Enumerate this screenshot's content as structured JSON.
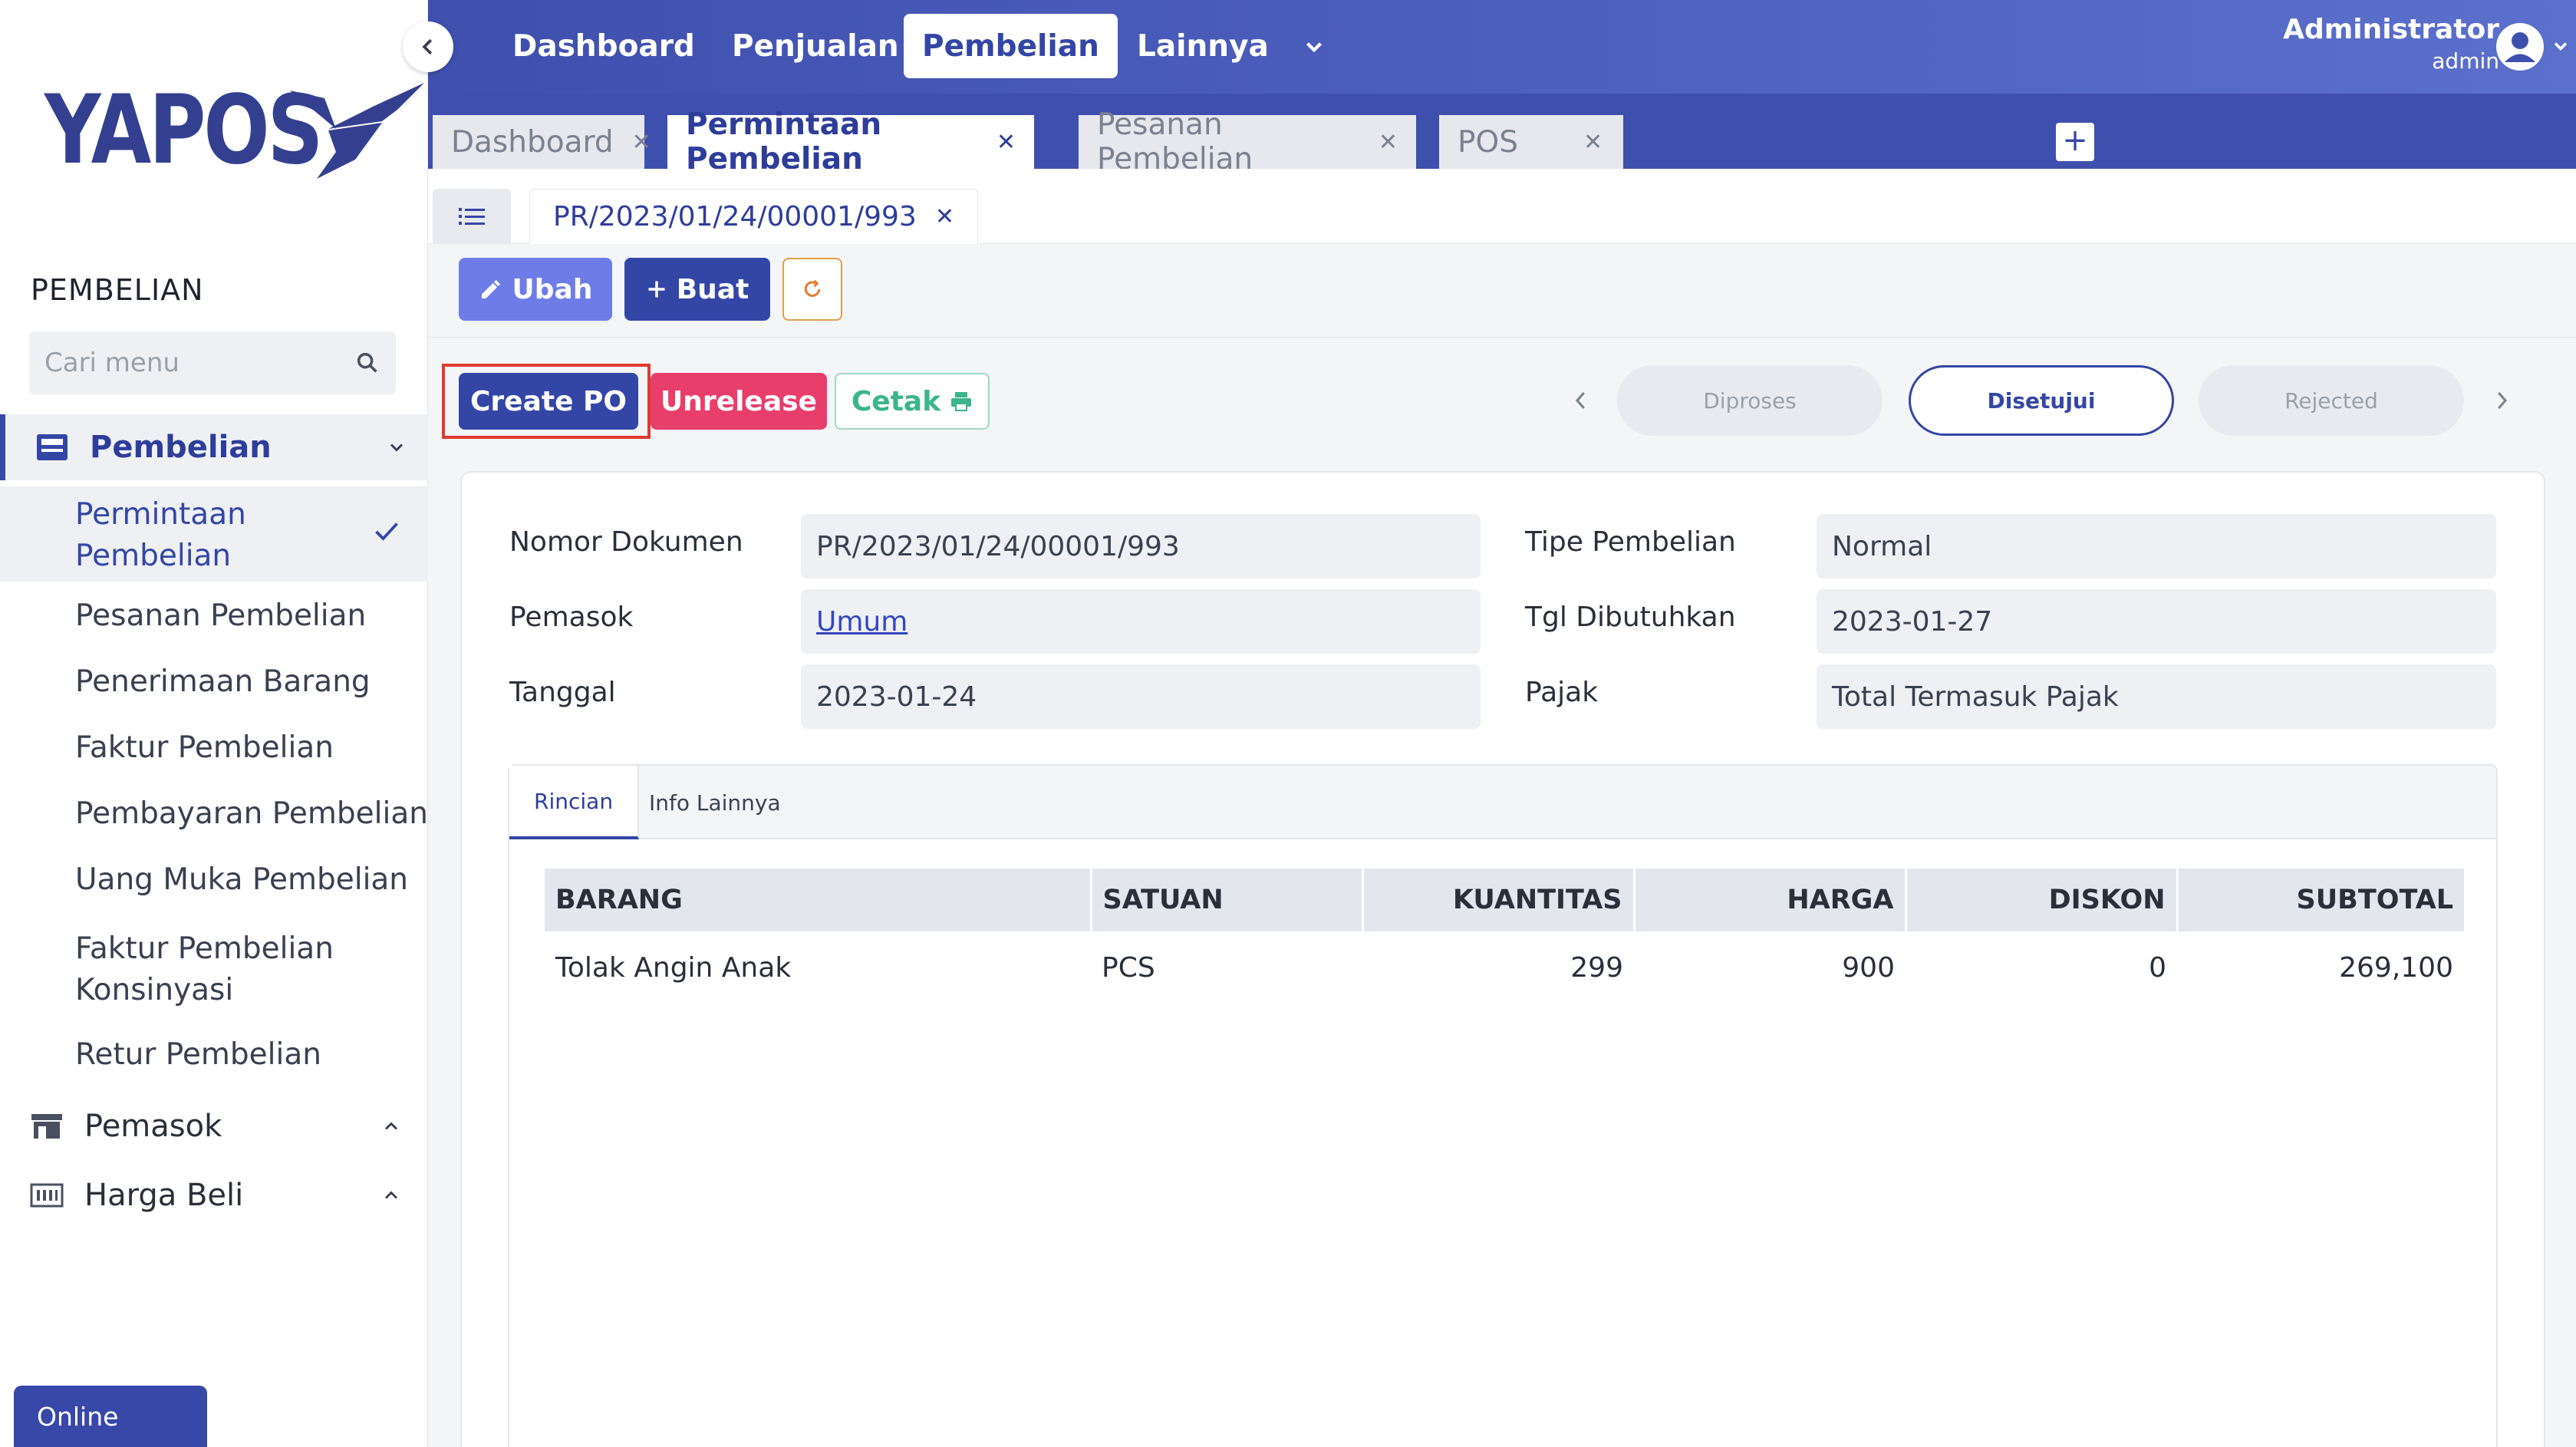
{
  "brand": {
    "name": "YAPOS",
    "accent": "#3446a5"
  },
  "sidebar": {
    "section_title": "PEMBELIAN",
    "search_placeholder": "Cari menu",
    "groups": [
      {
        "label": "Pembelian",
        "icon": "inbox-icon",
        "expanded": true
      },
      {
        "label": "Pemasok",
        "icon": "store-icon",
        "expanded": false
      },
      {
        "label": "Harga Beli",
        "icon": "price-tag-icon",
        "expanded": false
      }
    ],
    "items": [
      {
        "label": "Permintaan Pembelian",
        "active": true
      },
      {
        "label": "Pesanan Pembelian"
      },
      {
        "label": "Penerimaan Barang"
      },
      {
        "label": "Faktur Pembelian"
      },
      {
        "label": "Pembayaran Pembelian"
      },
      {
        "label": "Uang Muka Pembelian"
      },
      {
        "label": "Faktur Pembelian Konsinyasi"
      },
      {
        "label": "Retur Pembelian"
      }
    ],
    "status": "Online"
  },
  "topnav": {
    "items": [
      "Dashboard",
      "Penjualan",
      "Pembelian",
      "Lainnya"
    ],
    "active": "Pembelian",
    "user_name": "Administrator",
    "user_role": "admin"
  },
  "page_tabs": [
    "Dashboard",
    "Permintaan Pembelian",
    "Pesanan Pembelian",
    "POS"
  ],
  "page_tab_active": "Permintaan Pembelian",
  "add_tab_label": "+",
  "doc_tab": "PR/2023/01/24/00001/993",
  "toolbar": {
    "edit_label": "Ubah",
    "create_label": "Buat"
  },
  "actions": {
    "create_po": "Create PO",
    "unrelease": "Unrelease",
    "print": "Cetak"
  },
  "status_steps": [
    {
      "label": "Diproses",
      "active": false
    },
    {
      "label": "Disetujui",
      "active": true
    },
    {
      "label": "Rejected",
      "active": false
    }
  ],
  "form": {
    "nomor_dokumen": {
      "label": "Nomor Dokumen",
      "value": "PR/2023/01/24/00001/993"
    },
    "pemasok": {
      "label": "Pemasok",
      "value": "Umum"
    },
    "tanggal": {
      "label": "Tanggal",
      "value": "2023-01-24"
    },
    "tipe_pembelian": {
      "label": "Tipe Pembelian",
      "value": "Normal"
    },
    "tgl_dibutuhkan": {
      "label": "Tgl Dibutuhkan",
      "value": "2023-01-27"
    },
    "pajak": {
      "label": "Pajak",
      "value": "Total Termasuk Pajak"
    }
  },
  "inner_tabs": [
    "Rincian",
    "Info Lainnya"
  ],
  "table": {
    "headers": [
      "BARANG",
      "SATUAN",
      "KUANTITAS",
      "HARGA",
      "DISKON",
      "SUBTOTAL"
    ],
    "rows": [
      [
        "Tolak Angin Anak",
        "PCS",
        "299",
        "900",
        "0",
        "269,100"
      ]
    ]
  }
}
